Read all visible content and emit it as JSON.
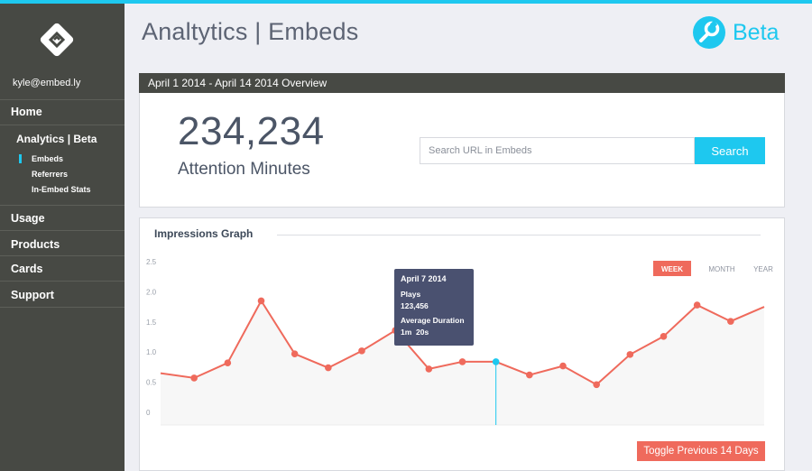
{
  "app": {
    "title": "Analtytics | Embeds",
    "badge": "Beta"
  },
  "sidebar": {
    "user": "kyle@embed.ly",
    "items": [
      {
        "label": "Home"
      },
      {
        "label": "Usage"
      },
      {
        "label": "Products"
      },
      {
        "label": "Cards"
      },
      {
        "label": "Support"
      }
    ],
    "analytics": {
      "label": "Analytics | Beta",
      "subitems": [
        {
          "label": "Embeds",
          "active": true
        },
        {
          "label": "Referrers",
          "active": false
        },
        {
          "label": "In-Embed Stats",
          "active": false
        }
      ]
    }
  },
  "overview": {
    "header": "April 1 2014 - April 14 2014 Overview",
    "value": "234,234",
    "value_label": "Attention Minutes",
    "search": {
      "placeholder": "Search URL in Embeds",
      "button": "Search"
    }
  },
  "graph": {
    "title": "Impressions Graph",
    "ranges": [
      {
        "label": "WEEK",
        "active": true
      },
      {
        "label": "MONTH",
        "active": false
      },
      {
        "label": "YEAR",
        "active": false
      }
    ],
    "tooltip": {
      "date": "April 7 2014",
      "plays_label": "Plays",
      "plays_value": "123,456",
      "duration_label": "Average Duration",
      "duration_value": "1m  20s"
    },
    "toggle_button": "Toggle Previous 14 Days",
    "colors": {
      "line": "#ef6a5c",
      "highlight": "#1ec8ef",
      "accent": "#1ec8ef",
      "tooltip_bg": "#4a5170"
    }
  },
  "chart_data": {
    "type": "line",
    "y_ticks": [
      "2.5",
      "2.0",
      "1.5",
      "1.0",
      "0.5",
      "0"
    ],
    "ylim": [
      0,
      2.5
    ],
    "grid": false,
    "highlight_index": 10,
    "series": [
      {
        "values": [
          0.65,
          0.57,
          0.82,
          1.85,
          0.97,
          0.74,
          1.02,
          1.36,
          0.72,
          0.84,
          0.84,
          0.62,
          0.77,
          0.46,
          0.96,
          1.26,
          1.78,
          1.51,
          1.75
        ]
      }
    ]
  }
}
